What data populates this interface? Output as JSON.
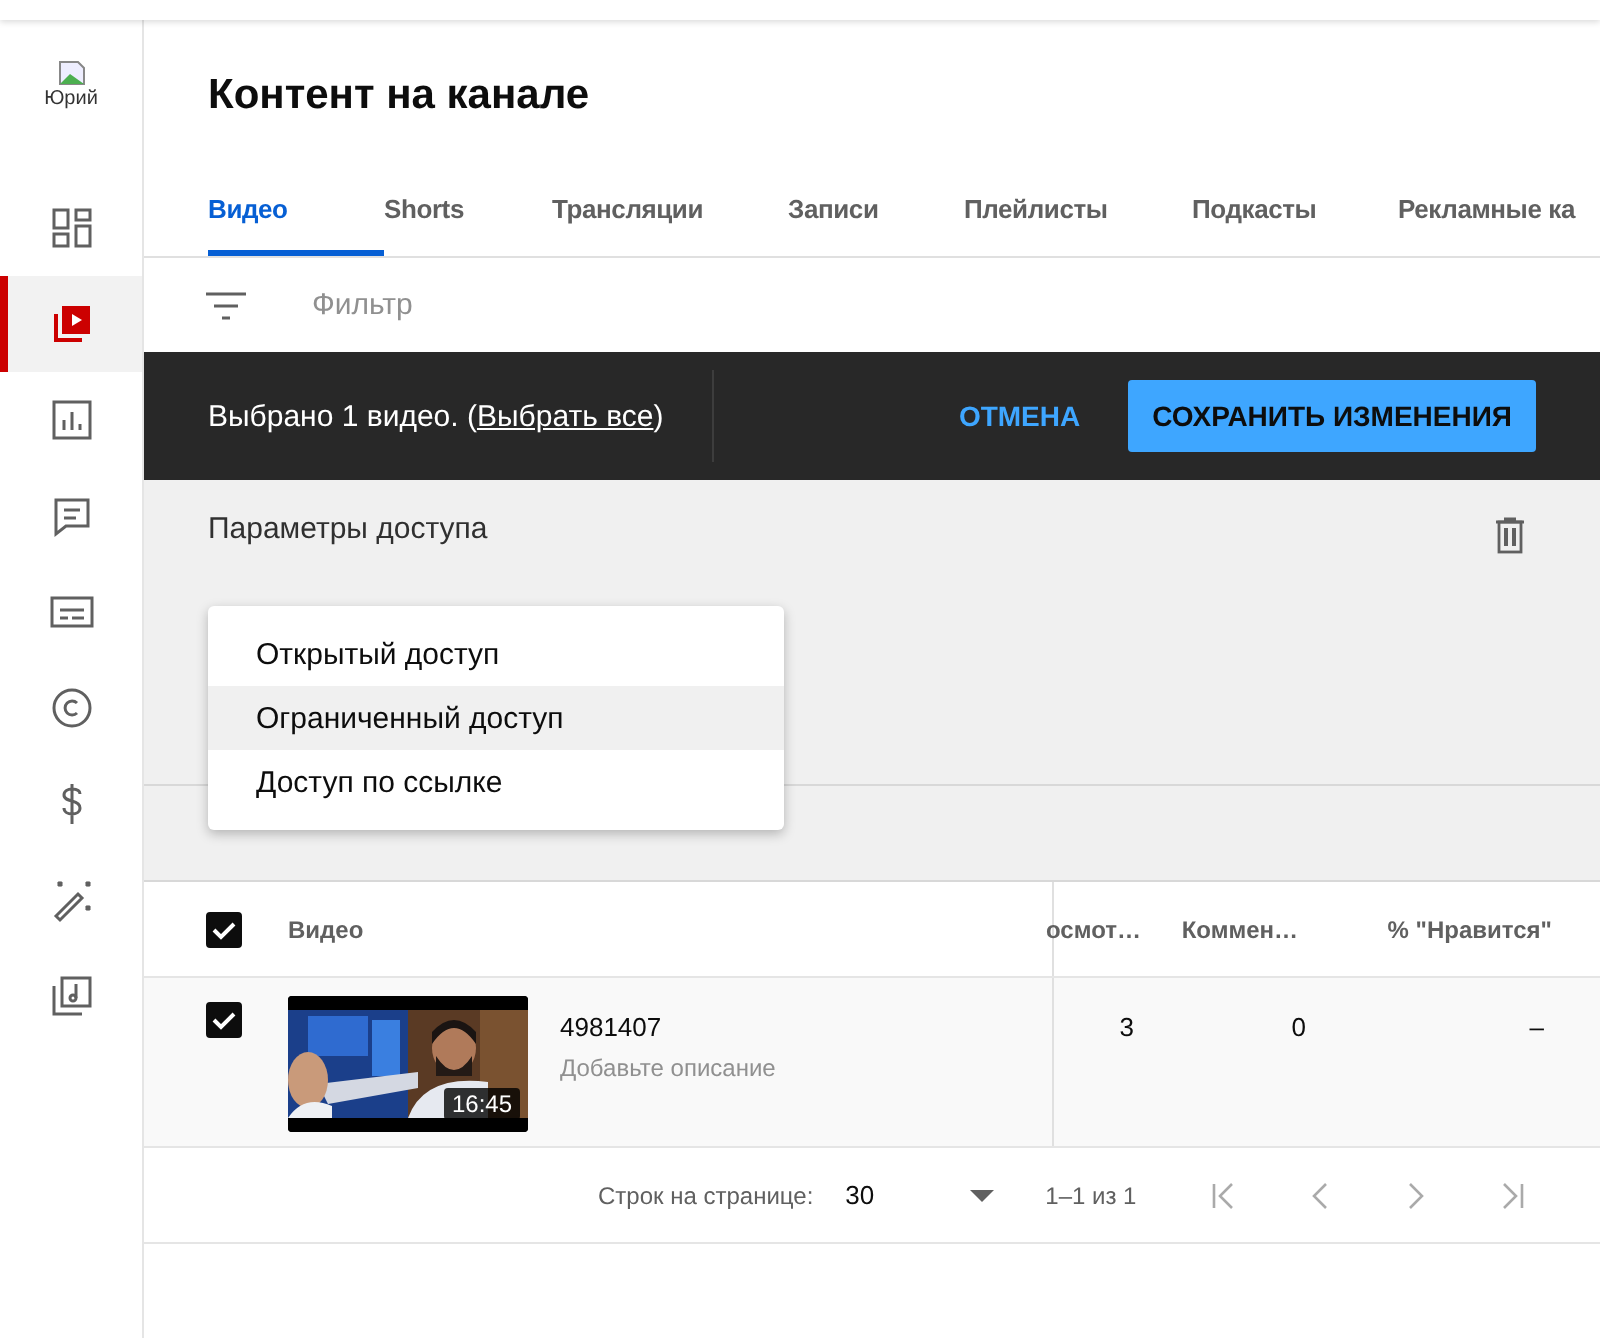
{
  "sidebar": {
    "avatar_alt": "Юрий",
    "items": [
      {
        "kind": "dashboard",
        "selected": false
      },
      {
        "kind": "content",
        "selected": true
      },
      {
        "kind": "analytics",
        "selected": false
      },
      {
        "kind": "comments",
        "selected": false
      },
      {
        "kind": "subtitles",
        "selected": false
      },
      {
        "kind": "copyright",
        "selected": false
      },
      {
        "kind": "earn",
        "selected": false
      },
      {
        "kind": "customize",
        "selected": false
      },
      {
        "kind": "audio",
        "selected": false
      }
    ]
  },
  "page_title": "Контент на канале",
  "tabs": [
    {
      "label": "Видео",
      "selected": true
    },
    {
      "label": "Shorts",
      "selected": false
    },
    {
      "label": "Трансляции",
      "selected": false
    },
    {
      "label": "Записи",
      "selected": false
    },
    {
      "label": "Плейлисты",
      "selected": false
    },
    {
      "label": "Подкасты",
      "selected": false
    },
    {
      "label": "Рекламные ка",
      "selected": false
    }
  ],
  "filter": {
    "placeholder": "Фильтр"
  },
  "selection_bar": {
    "text": "Выбрано 1 видео. (",
    "link": "Выбрать все",
    "text_end": ")",
    "cancel": "ОТМЕНА",
    "save": "СОХРАНИТЬ ИЗМЕНЕНИЯ"
  },
  "access_panel": {
    "title": "Параметры доступа",
    "menu": [
      {
        "label": "Открытый доступ",
        "highlighted": false
      },
      {
        "label": "Ограниченный доступ",
        "highlighted": true
      },
      {
        "label": "Доступ по ссылке",
        "highlighted": false
      }
    ]
  },
  "table": {
    "header_checked": true,
    "columns": [
      "Видео",
      "осмот…",
      "Коммен…",
      "% \"Нравится\""
    ],
    "rows": [
      {
        "checked": true,
        "title": "4981407",
        "description": "Добавьте описание",
        "duration": "16:45",
        "views": "3",
        "comments": "0",
        "likes": "–"
      }
    ]
  },
  "pagination": {
    "rows_label": "Строк на странице:",
    "rows_value": "30",
    "range": "1–1 из 1"
  }
}
